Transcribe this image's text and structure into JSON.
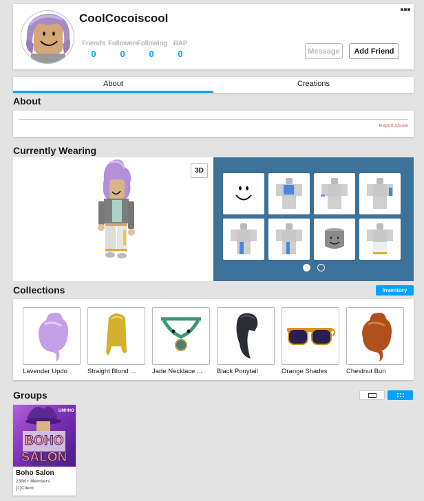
{
  "profile": {
    "username": "CoolCocoiscool",
    "stats": [
      {
        "label": "Friends",
        "value": "0"
      },
      {
        "label": "Followers",
        "value": "0"
      },
      {
        "label": "Following",
        "value": "0"
      },
      {
        "label": "RAP",
        "value": "0"
      }
    ],
    "message_label": "Message",
    "add_friend_label": "Add Friend",
    "more_icon": "more-options-icon"
  },
  "tabs": [
    {
      "label": "About",
      "active": true
    },
    {
      "label": "Creations",
      "active": false
    }
  ],
  "about": {
    "title": "About",
    "report_abuse": "Report Abuse"
  },
  "wearing": {
    "title": "Currently Wearing",
    "toggle_3d": "3D",
    "items": [
      "smile-face",
      "blue-shirt",
      "arm-accessory",
      "blue-sleeve",
      "blue-pants",
      "blue-pants-2",
      "gray-head",
      "white-pants"
    ],
    "page_count": 2,
    "active_page": 1
  },
  "collections": {
    "title": "Collections",
    "inventory_label": "Inventory",
    "items": [
      {
        "name": "Lavender Updo",
        "color": "#c9a0e8"
      },
      {
        "name": "Straight Blond ...",
        "color": "#d4b030"
      },
      {
        "name": "Jade Necklace ...",
        "color": "#3a9a70"
      },
      {
        "name": "Black Ponytail",
        "color": "#2a2d36"
      },
      {
        "name": "Orange Shades",
        "color": "#d4961a"
      },
      {
        "name": "Chestnut Bun",
        "color": "#b0501a"
      }
    ]
  },
  "groups": {
    "title": "Groups",
    "items": [
      {
        "name": "Boho Salon",
        "members": "230K+ Members",
        "role": "[1]Client",
        "image_text_top": "BOHO",
        "image_text_bottom": "SALON",
        "image_badge": "UMHNO"
      }
    ]
  },
  "colors": {
    "accent": "#00a2ff",
    "wearing_panel": "#3c7199",
    "background": "#e3e3e3"
  }
}
